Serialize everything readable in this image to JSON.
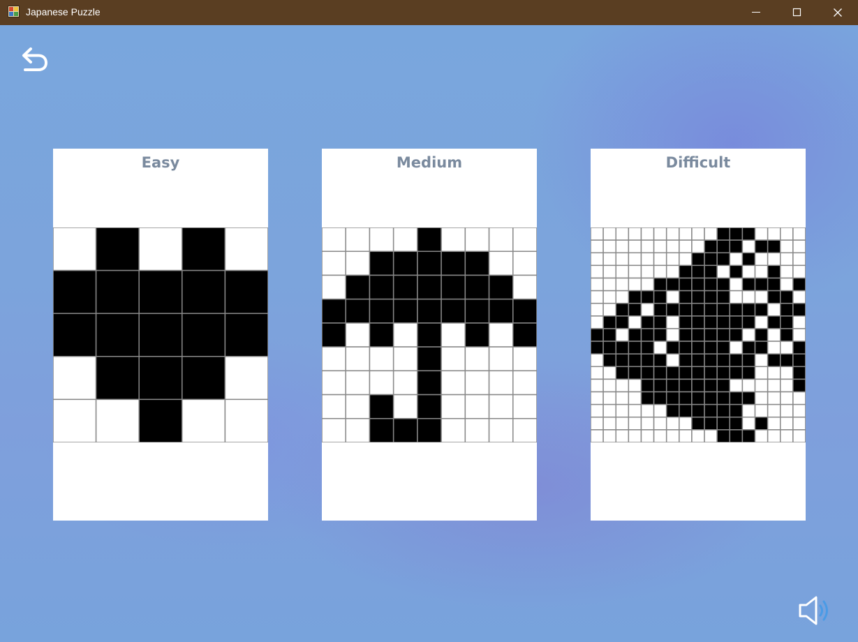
{
  "window": {
    "title": "Japanese Puzzle",
    "controls": [
      "minimize",
      "maximize",
      "close"
    ],
    "titlebar_color": "#5a3e22"
  },
  "toolbar": {
    "back_icon": "undo-arrow-icon",
    "sound_icon": "speaker-icon"
  },
  "colors": {
    "filled": "#000000",
    "empty": "#ffffff",
    "grid_line": "#888888",
    "label": "#7a8a9e"
  },
  "cards": [
    {
      "label": "Easy",
      "grid": [
        "01010",
        "11111",
        "11111",
        "01110",
        "00100"
      ]
    },
    {
      "label": "Medium",
      "grid": [
        "000010000",
        "001111100",
        "011111110",
        "111111111",
        "101010101",
        "000010000",
        "000010000",
        "001010000",
        "001110000"
      ]
    },
    {
      "label": "Difficult",
      "grid": [
        "000000000011100000",
        "000000000111011001",
        "000000001110100001",
        "000000011101001001",
        "000001111110111011",
        "000111011110001101",
        "001101111111110110",
        "011011011111101100",
        "110111011111010101",
        "111110111110110011",
        "011111011111101111",
        "001111111111100011",
        "000011111110000011",
        "000011111111100001",
        "000000111111000001",
        "000000001111010000",
        "000000000011100000"
      ]
    }
  ]
}
